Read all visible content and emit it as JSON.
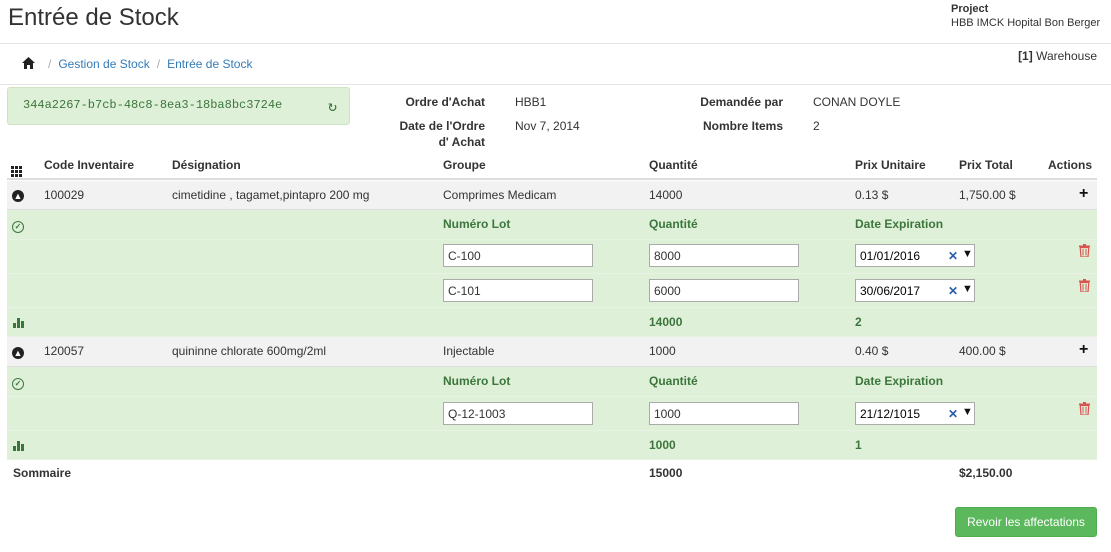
{
  "header": {
    "title": "Entrée de Stock",
    "project_label": "Project",
    "project_name": "HBB IMCK Hopital Bon Berger"
  },
  "breadcrumb": {
    "items": [
      "Gestion de Stock",
      "Entrée de Stock"
    ]
  },
  "warehouse": {
    "index": "[1]",
    "name": "Warehouse"
  },
  "uuid": "344a2267-b7cb-48c8-8ea3-18ba8bc3724e",
  "order": {
    "ordre_label": "Ordre d'Achat",
    "ordre_value": "HBB1",
    "date_label_1": "Date de l'Ordre",
    "date_label_2": "d' Achat",
    "date_value": "Nov 7, 2014",
    "demandee_label": "Demandée par",
    "demandee_value": "CONAN DOYLE",
    "nombre_label": "Nombre Items",
    "nombre_value": "2"
  },
  "table": {
    "headers": {
      "code": "Code Inventaire",
      "designation": "Désignation",
      "groupe": "Groupe",
      "quantite": "Quantité",
      "prix_unitaire": "Prix Unitaire",
      "prix_total": "Prix Total",
      "actions": "Actions"
    },
    "lot_headers": {
      "numero_lot": "Numéro Lot",
      "quantite": "Quantité",
      "date_expiration": "Date Expiration"
    },
    "items": [
      {
        "code": "100029",
        "designation": "cimetidine , tagamet,pintapro 200 mg",
        "groupe": "Comprimes Medicam",
        "quantite": "14000",
        "prix_unitaire": "0.13 $",
        "prix_total": "1,750.00 $",
        "lots": [
          {
            "numero": "C-100",
            "quantite": "8000",
            "date": "01/01/2016"
          },
          {
            "numero": "C-101",
            "quantite": "6000",
            "date": "30/06/2017"
          }
        ],
        "total_quantite": "14000",
        "total_lots": "2"
      },
      {
        "code": "120057",
        "designation": "quininne chlorate 600mg/2ml",
        "groupe": "Injectable",
        "quantite": "1000",
        "prix_unitaire": "0.40 $",
        "prix_total": "400.00 $",
        "lots": [
          {
            "numero": "Q-12-1003",
            "quantite": "1000",
            "date": "21/12/1015"
          }
        ],
        "total_quantite": "1000",
        "total_lots": "1"
      }
    ],
    "summary": {
      "label": "Sommaire",
      "quantite": "15000",
      "prix_total": "$2,150.00"
    }
  },
  "buttons": {
    "revoir": "Revoir les affectations"
  }
}
